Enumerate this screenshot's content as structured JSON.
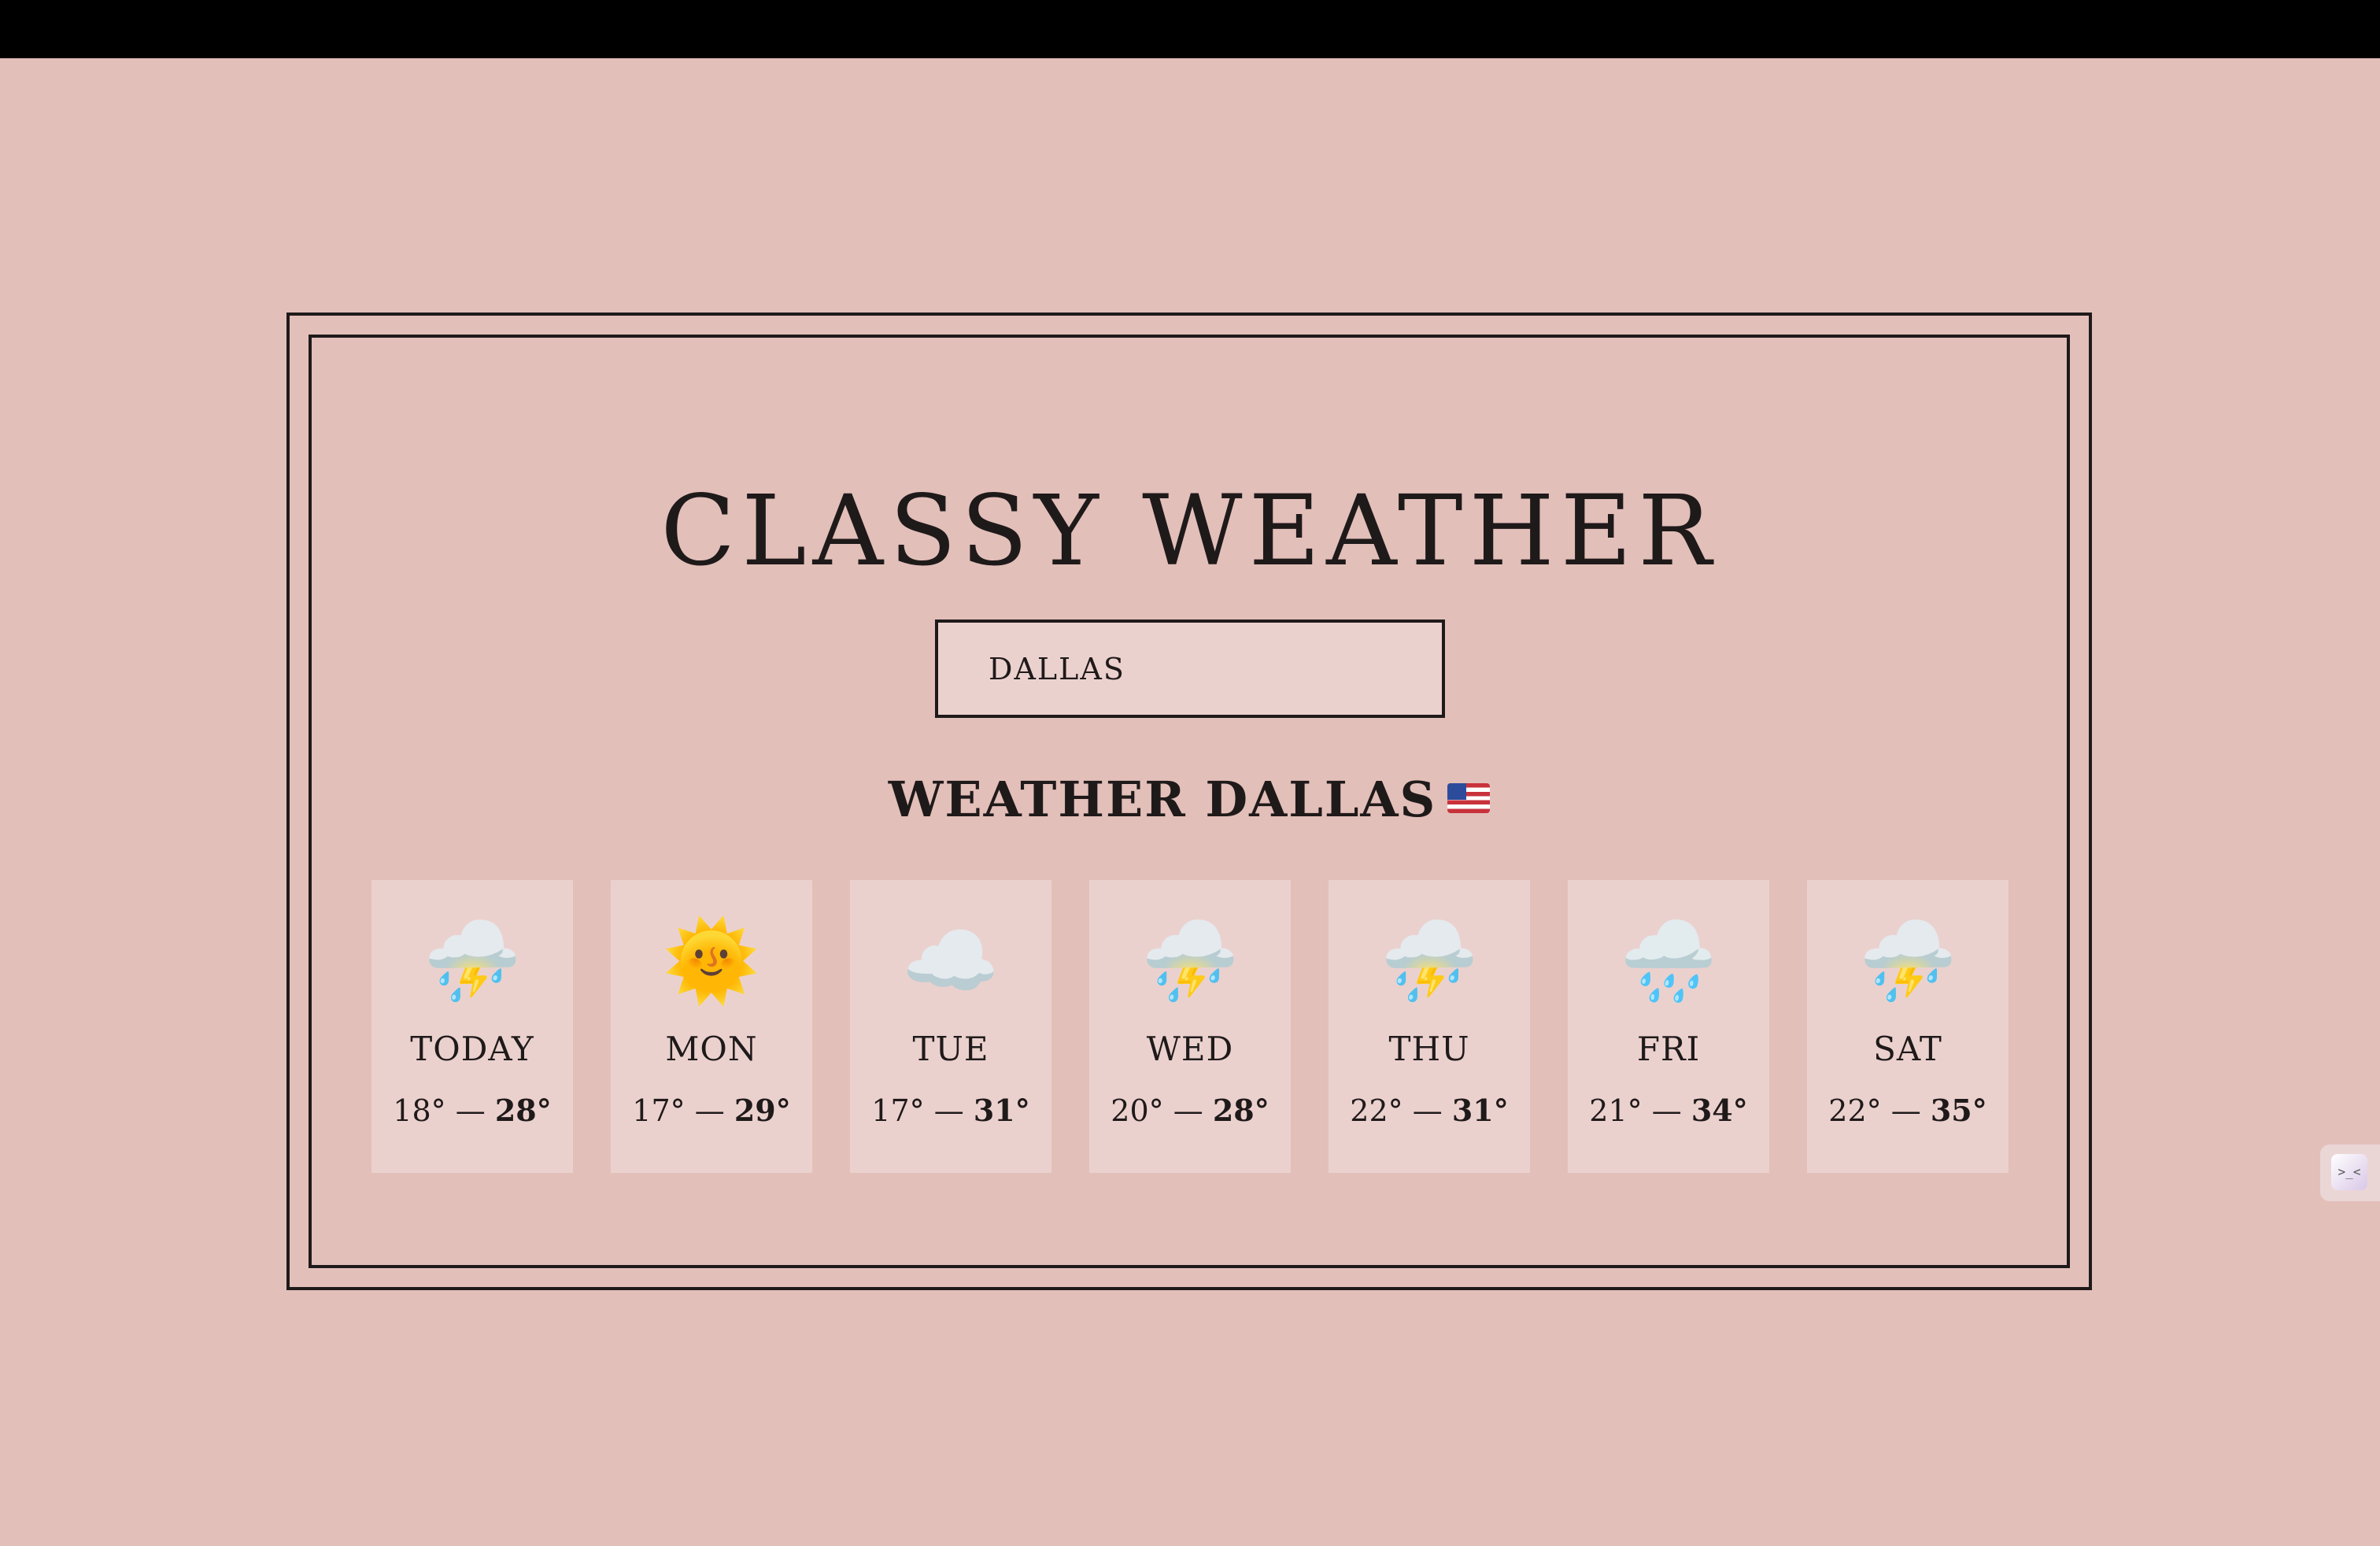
{
  "app": {
    "title": "Classy Weather"
  },
  "search": {
    "value": "DALLAS"
  },
  "location": {
    "heading": "Weather DALLAS",
    "flag_icon": "us-flag-icon"
  },
  "forecast": [
    {
      "day": "TODAY",
      "icon": "thunderstorm-icon",
      "glyph": "⛈️",
      "low": "18°",
      "high": "28°"
    },
    {
      "day": "MON",
      "icon": "sun-icon",
      "glyph": "🌞",
      "low": "17°",
      "high": "29°"
    },
    {
      "day": "TUE",
      "icon": "cloud-icon",
      "glyph": "☁️",
      "low": "17°",
      "high": "31°"
    },
    {
      "day": "WED",
      "icon": "thunderstorm-icon",
      "glyph": "⛈️",
      "low": "20°",
      "high": "28°"
    },
    {
      "day": "THU",
      "icon": "thunderstorm-icon",
      "glyph": "⛈️",
      "low": "22°",
      "high": "31°"
    },
    {
      "day": "FRI",
      "icon": "rain-icon",
      "glyph": "🌧️",
      "low": "21°",
      "high": "34°"
    },
    {
      "day": "SAT",
      "icon": "thunderstorm-icon",
      "glyph": "⛈️",
      "low": "22°",
      "high": "35°"
    }
  ],
  "temp_separator": " — ",
  "colors": {
    "background": "#e3bfba",
    "card": "#ebd1ce",
    "ink": "#1f1a1a",
    "top_bar": "#000000"
  },
  "widget": {
    "icon": "extension-widget-icon",
    "glyph": ">_<"
  }
}
